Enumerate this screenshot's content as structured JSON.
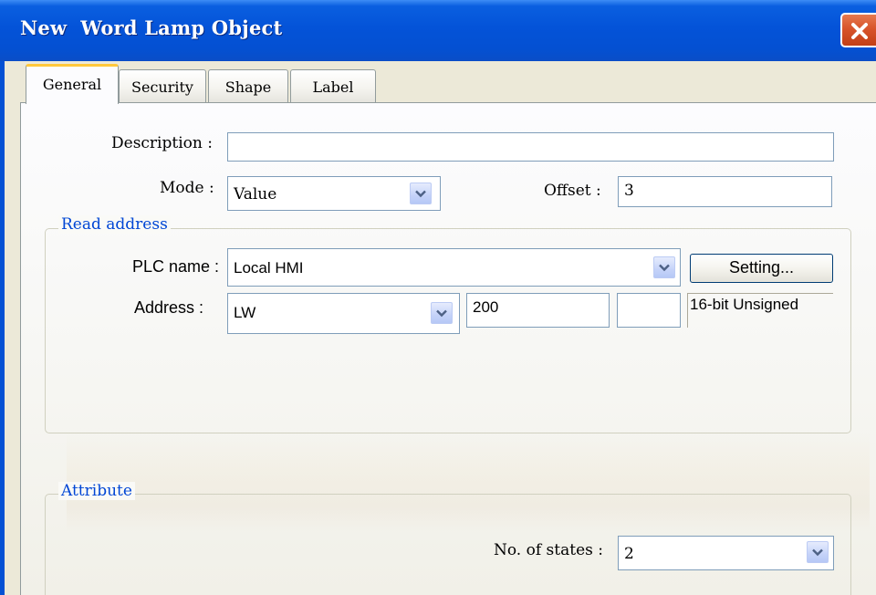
{
  "window": {
    "title": "New  Word Lamp Object"
  },
  "tabs": [
    {
      "label": "General",
      "active": true
    },
    {
      "label": "Security",
      "active": false
    },
    {
      "label": "Shape",
      "active": false
    },
    {
      "label": "Label",
      "active": false
    }
  ],
  "general": {
    "description_label": "Description :",
    "description_value": "",
    "mode_label": "Mode :",
    "mode_value": "Value",
    "offset_label": "Offset :",
    "offset_value": "3"
  },
  "read_address": {
    "legend": "Read address",
    "plc_label": "PLC name :",
    "plc_value": "Local HMI",
    "setting_button": "Setting...",
    "address_label": "Address :",
    "device_type": "LW",
    "address_value": "200",
    "suffix_value": "",
    "data_format": "16-bit Unsigned"
  },
  "attribute": {
    "legend": "Attribute",
    "states_label": "No. of states :",
    "states_value": "2"
  },
  "colors": {
    "title_bar": "#0453d8",
    "legend_text": "#0046d5",
    "active_tab_accent": "#ffc83c"
  },
  "icons": [
    "close-icon",
    "chevron-down-icon"
  ]
}
